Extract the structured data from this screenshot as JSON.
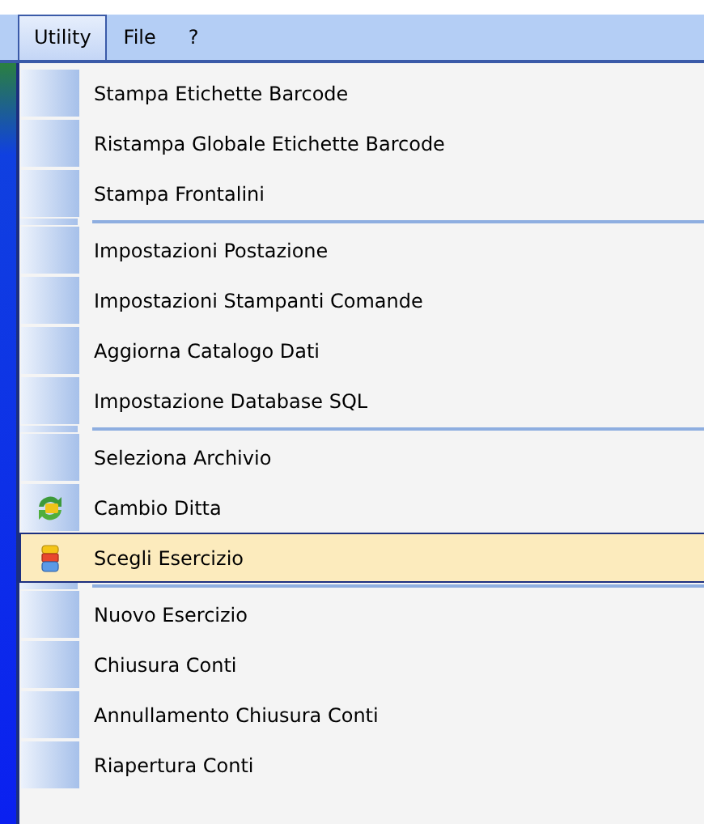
{
  "menubar": [
    {
      "label": "Utility",
      "selected": true
    },
    {
      "label": "File",
      "selected": false
    },
    {
      "label": "?",
      "selected": false
    }
  ],
  "menu": {
    "groups": [
      {
        "items": [
          {
            "label": "Stampa Etichette Barcode",
            "kind": "plain",
            "selected": false
          },
          {
            "label": "Ristampa Globale Etichette Barcode",
            "kind": "plain",
            "selected": false
          },
          {
            "label": "Stampa Frontalini",
            "kind": "plain",
            "selected": false
          }
        ]
      },
      {
        "items": [
          {
            "label": "Impostazioni Postazione",
            "kind": "plain",
            "selected": false
          },
          {
            "label": "Impostazioni Stampanti Comande",
            "kind": "plain",
            "selected": false
          },
          {
            "label": "Aggiorna Catalogo Dati",
            "kind": "plain",
            "selected": false
          },
          {
            "label": "Impostazione Database SQL",
            "kind": "plain",
            "selected": false
          }
        ]
      },
      {
        "items": [
          {
            "label": "Seleziona Archivio",
            "kind": "plain",
            "selected": false
          },
          {
            "label": "Cambio Ditta",
            "kind": "swap",
            "selected": false
          },
          {
            "label": "Scegli Esercizio",
            "kind": "stack",
            "selected": true
          }
        ]
      },
      {
        "items": [
          {
            "label": "Nuovo Esercizio",
            "kind": "plain",
            "selected": false
          },
          {
            "label": "Chiusura Conti",
            "kind": "plain",
            "selected": false
          },
          {
            "label": "Annullamento Chiusura Conti",
            "kind": "plain",
            "selected": false
          },
          {
            "label": "Riapertura Conti",
            "kind": "plain",
            "selected": false
          }
        ]
      }
    ]
  }
}
